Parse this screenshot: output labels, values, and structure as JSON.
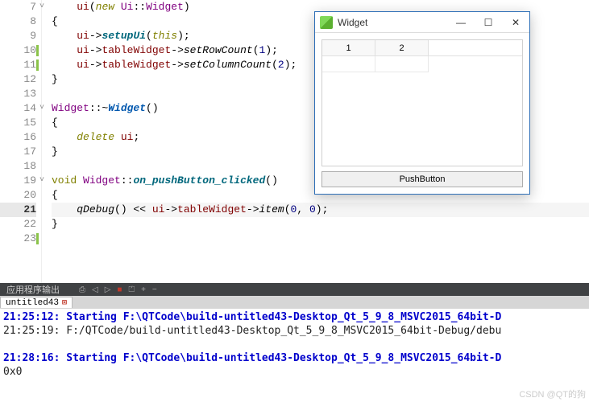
{
  "editor": {
    "lines": [
      {
        "n": "7",
        "fold": "v",
        "bar": false
      },
      {
        "n": "8",
        "fold": "",
        "bar": false
      },
      {
        "n": "9",
        "fold": "",
        "bar": false
      },
      {
        "n": "10",
        "fold": "",
        "bar": true
      },
      {
        "n": "11",
        "fold": "",
        "bar": true
      },
      {
        "n": "12",
        "fold": "",
        "bar": false
      },
      {
        "n": "13",
        "fold": "",
        "bar": false
      },
      {
        "n": "14",
        "fold": "v",
        "bar": false
      },
      {
        "n": "15",
        "fold": "",
        "bar": false
      },
      {
        "n": "16",
        "fold": "",
        "bar": false
      },
      {
        "n": "17",
        "fold": "",
        "bar": false
      },
      {
        "n": "18",
        "fold": "",
        "bar": false
      },
      {
        "n": "19",
        "fold": "v",
        "bar": false
      },
      {
        "n": "20",
        "fold": "",
        "bar": false
      },
      {
        "n": "21",
        "fold": "",
        "bar": false,
        "cur": true
      },
      {
        "n": "22",
        "fold": "",
        "bar": false
      },
      {
        "n": "23",
        "fold": "",
        "bar": true
      }
    ],
    "code": {
      "l7_ui": "ui",
      "l7_new": "new",
      "l7_ns": "Ui",
      "l7_cls": "Widget",
      "l8": "{",
      "l9_ui": "ui",
      "l9_arrow": "->",
      "l9_fn": "setupUi",
      "l9_this": "this",
      "l9_end": ");",
      "l10_ui": "ui",
      "l10_arrow": "->",
      "l10_mem": "tableWidget",
      "l10_arrow2": "->",
      "l10_fn": "setRowCount",
      "l10_arg": "1",
      "l10_end": ");",
      "l11_ui": "ui",
      "l11_arrow": "->",
      "l11_mem": "tableWidget",
      "l11_arrow2": "->",
      "l11_fn": "setColumnCount",
      "l11_arg": "2",
      "l11_end": ");",
      "l12": "}",
      "l14_cls": "Widget",
      "l14_dtor": "Widget",
      "l14_sig": "()",
      "l15": "{",
      "l16_del": "delete",
      "l16_ui": " ui",
      "l17": "}",
      "l19_void": "void",
      "l19_cls": "Widget",
      "l19_fn": "on_pushButton_clicked",
      "l19_sig": "()",
      "l20": "{",
      "l21_qd": "qDebug",
      "l21_p": "() << ",
      "l21_ui": "ui",
      "l21_arrow": "->",
      "l21_mem": "tableWidget",
      "l21_arrow2": "->",
      "l21_fn": "item",
      "l21_a1": "0",
      "l21_c": ", ",
      "l21_a2": "0",
      "l21_end": ");",
      "l22": "}"
    }
  },
  "panel": {
    "title": "应用程序输出",
    "tab": "untitled43"
  },
  "output": {
    "l1": "21:25:12: Starting F:\\QTCode\\build-untitled43-Desktop_Qt_5_9_8_MSVC2015_64bit-D",
    "l2": "21:25:19: F:/QTCode/build-untitled43-Desktop_Qt_5_9_8_MSVC2015_64bit-Debug/debu",
    "l3": "21:28:16: Starting F:\\QTCode\\build-untitled43-Desktop_Qt_5_9_8_MSVC2015_64bit-D",
    "l4": "0x0"
  },
  "qt": {
    "title": "Widget",
    "col1": "1",
    "col2": "2",
    "button": "PushButton"
  },
  "watermark": "CSDN @QT的狗"
}
